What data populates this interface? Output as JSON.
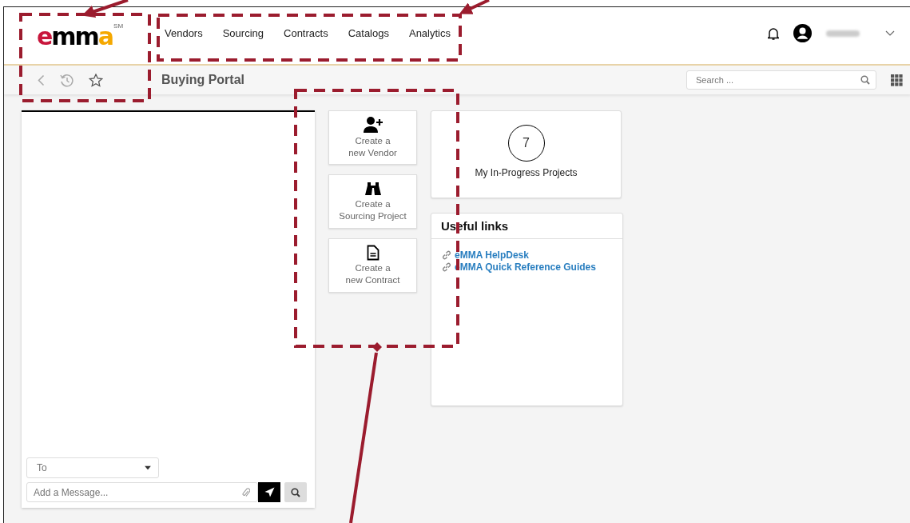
{
  "header": {
    "logo": {
      "word": "emma",
      "tm": "SM"
    },
    "nav": [
      {
        "label": "Vendors"
      },
      {
        "label": "Sourcing"
      },
      {
        "label": "Contracts"
      },
      {
        "label": "Catalogs"
      },
      {
        "label": "Analytics"
      }
    ]
  },
  "toolbar": {
    "title": "Buying Portal",
    "search": {
      "placeholder": "Search ..."
    }
  },
  "chat": {
    "to": {
      "placeholder": "To"
    },
    "message": {
      "placeholder": "Add a Message..."
    }
  },
  "tiles": [
    {
      "kind": "vendor",
      "lines": [
        "Create a",
        "new Vendor"
      ]
    },
    {
      "kind": "sourcing",
      "lines": [
        "Create a",
        "Sourcing Project"
      ]
    },
    {
      "kind": "contract",
      "lines": [
        "Create a",
        "new Contract"
      ]
    }
  ],
  "projects": {
    "count": "7",
    "label": "My In-Progress Projects"
  },
  "useful_links": {
    "title": "Useful links",
    "links": [
      "eMMA HelpDesk",
      "eMMA Quick Reference Guides"
    ]
  }
}
